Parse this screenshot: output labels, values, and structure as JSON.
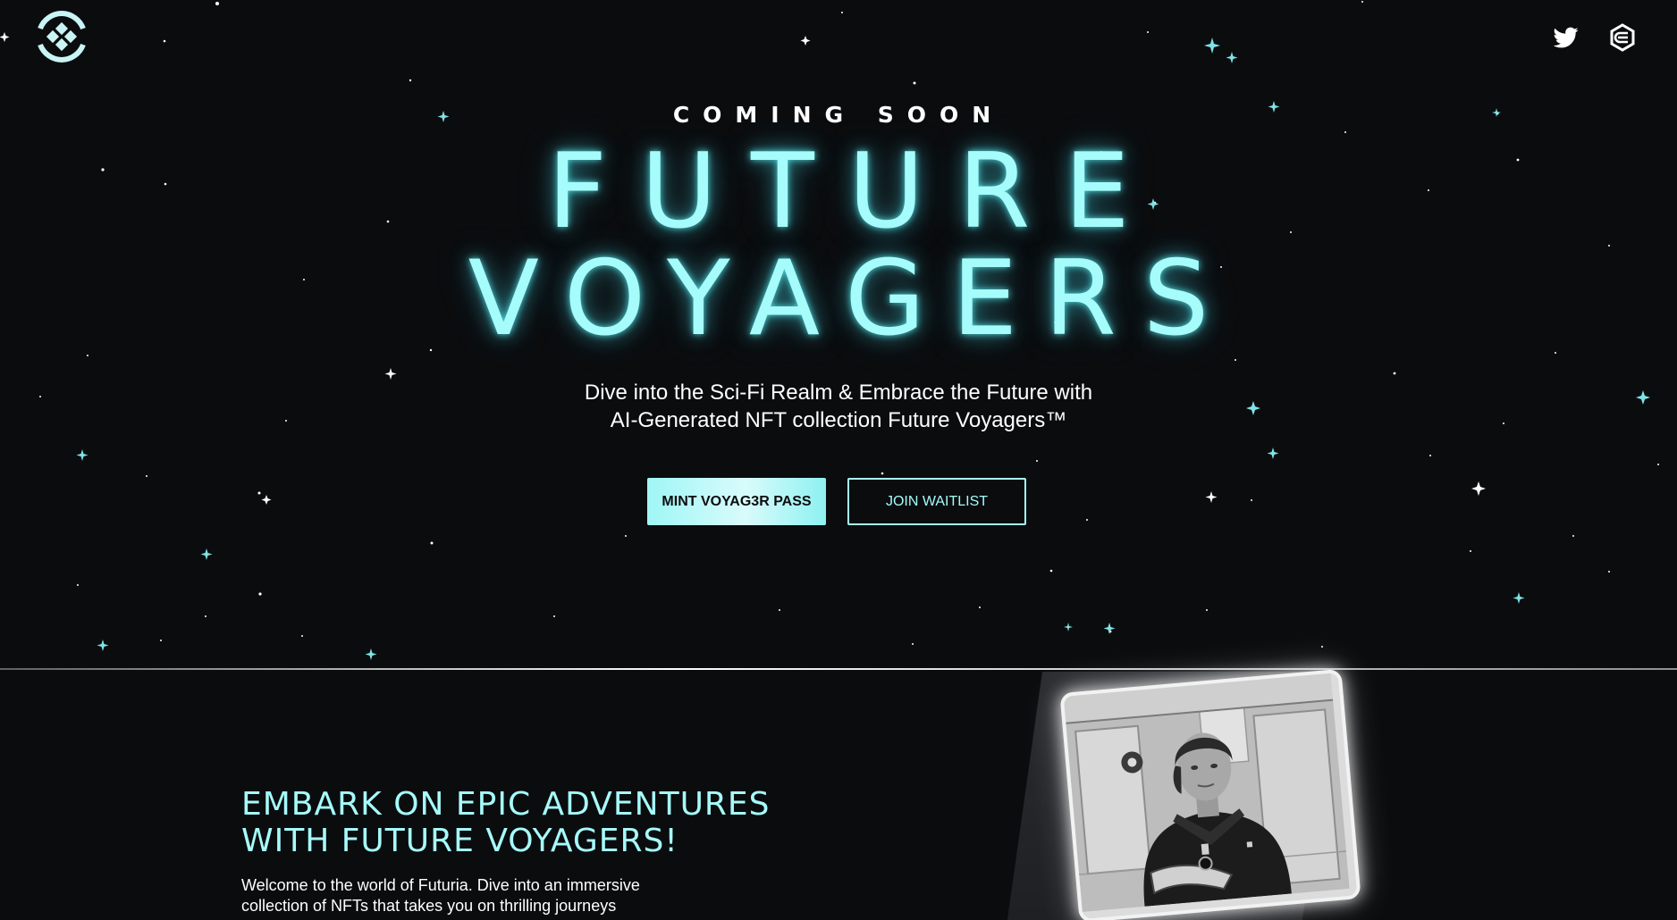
{
  "header": {
    "logo_icon": "voyagers-logo-icon",
    "social": [
      {
        "name": "twitter-icon"
      },
      {
        "name": "opensea-eth-icon"
      }
    ]
  },
  "hero": {
    "kicker": "COMING SOON",
    "title_line1": "FUTURE",
    "title_line2": "VOYAGERS",
    "subtitle_line1": "Dive into the Sci-Fi Realm & Embrace the Future with",
    "subtitle_line2": "AI-Generated NFT collection Future Voyagers™",
    "mint_label": "MINT VOYAG3R PASS",
    "waitlist_label": "JOIN WAITLIST"
  },
  "about": {
    "title_line1": "EMBARK ON EPIC ADVENTURES",
    "title_line2": "WITH FUTURE VOYAGERS!",
    "body_line1": "Welcome to the world of Futuria. Dive into an immersive",
    "body_line2": "collection of NFTs that takes you on thrilling journeys"
  },
  "colors": {
    "background": "#0b0c0e",
    "accent_cyan": "#a6fbfb",
    "text": "#ffffff"
  }
}
